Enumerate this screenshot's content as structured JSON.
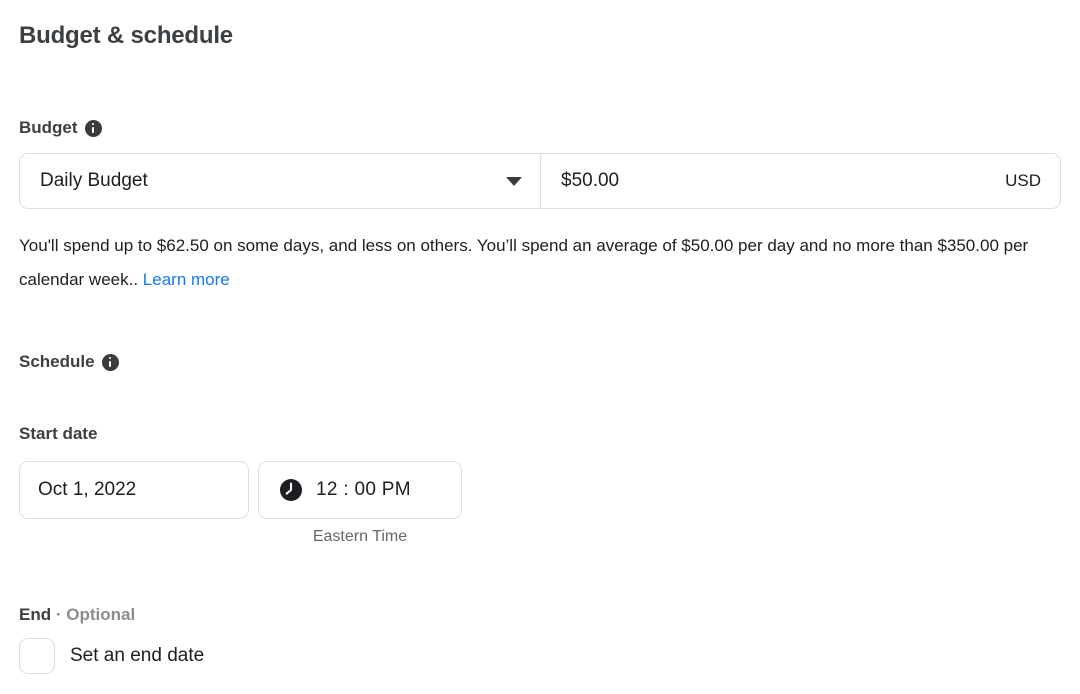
{
  "page": {
    "title": "Budget & schedule"
  },
  "budget": {
    "label": "Budget",
    "info_icon": "info-icon",
    "type_select": {
      "value": "Daily Budget",
      "caret_icon": "chevron-down-icon"
    },
    "amount": {
      "value": "$50.00",
      "currency": "USD"
    },
    "help_text_before_link": "You'll spend up to $62.50 on some days, and less on others. You’ll spend an average of $50.00 per day and no more than $350.00 per calendar week.. ",
    "help_link_label": "Learn more"
  },
  "schedule": {
    "label": "Schedule",
    "info_icon": "info-icon",
    "start_date": {
      "label": "Start date",
      "date_value": "Oct 1, 2022",
      "time_icon": "clock-icon",
      "time_value": "12 : 00 PM",
      "timezone": "Eastern Time"
    },
    "end": {
      "label": "End",
      "optional_suffix": "· Optional",
      "checkbox_label": "Set an end date",
      "checkbox_checked": false
    }
  },
  "colors": {
    "link": "#1877f2",
    "text_primary": "#1c1e21",
    "text_heading": "#3c4043",
    "text_muted": "#65676b",
    "text_optional": "#8a8d91",
    "border": "#dddfe2",
    "icon_fill": "#3a3b3c",
    "background": "#ffffff"
  }
}
